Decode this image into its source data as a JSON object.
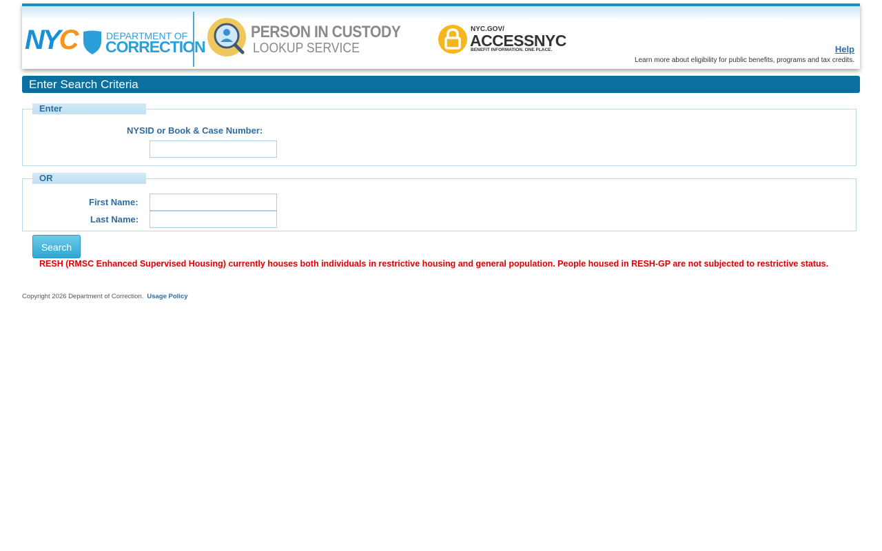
{
  "header": {
    "nyc_logo": "NYC",
    "department_line1": "DEPARTMENT OF",
    "department_line2": "CORRECTION",
    "service_line1": "PERSON IN CUSTODY",
    "service_line2": "LOOKUP SERVICE",
    "access_small": "NYC.GOV/",
    "access_big": "ACCESSNYC",
    "access_tagline": "BENEFIT INFORMATION. ONE PLACE.",
    "help_label": "Help",
    "help_text": "Learn more about eligibility for public benefits, programs and tax credits."
  },
  "title": "Enter Search Criteria",
  "enter_section": {
    "legend": "Enter",
    "label": "NYSID or Book & Case Number:",
    "value": ""
  },
  "or_section": {
    "legend": "OR",
    "first_name_label": "First Name:",
    "first_name_value": "",
    "last_name_label": "Last Name:",
    "last_name_value": ""
  },
  "search_button": "Search",
  "notice": "RESH (RMSC Enhanced Supervised Housing) currently houses both individuals in restrictive housing and general population. People housed in RESH-GP are not subjected to restrictive status.",
  "footer": {
    "copyright": "Copyright 2026 Department of Correction.",
    "usage_policy": "Usage Policy"
  },
  "colors": {
    "header_bar": "#1b8fc9",
    "title_bar": "#0b6f9f",
    "label_text": "#2e6b9e",
    "notice_text": "#e00000",
    "nyc_blue": "#1a8fd6",
    "nyc_orange": "#f7941d"
  },
  "icons": {
    "nyc_shield": "shield-icon",
    "pic_logo": "magnifier-person-icon",
    "access_logo": "padlock-icon"
  }
}
